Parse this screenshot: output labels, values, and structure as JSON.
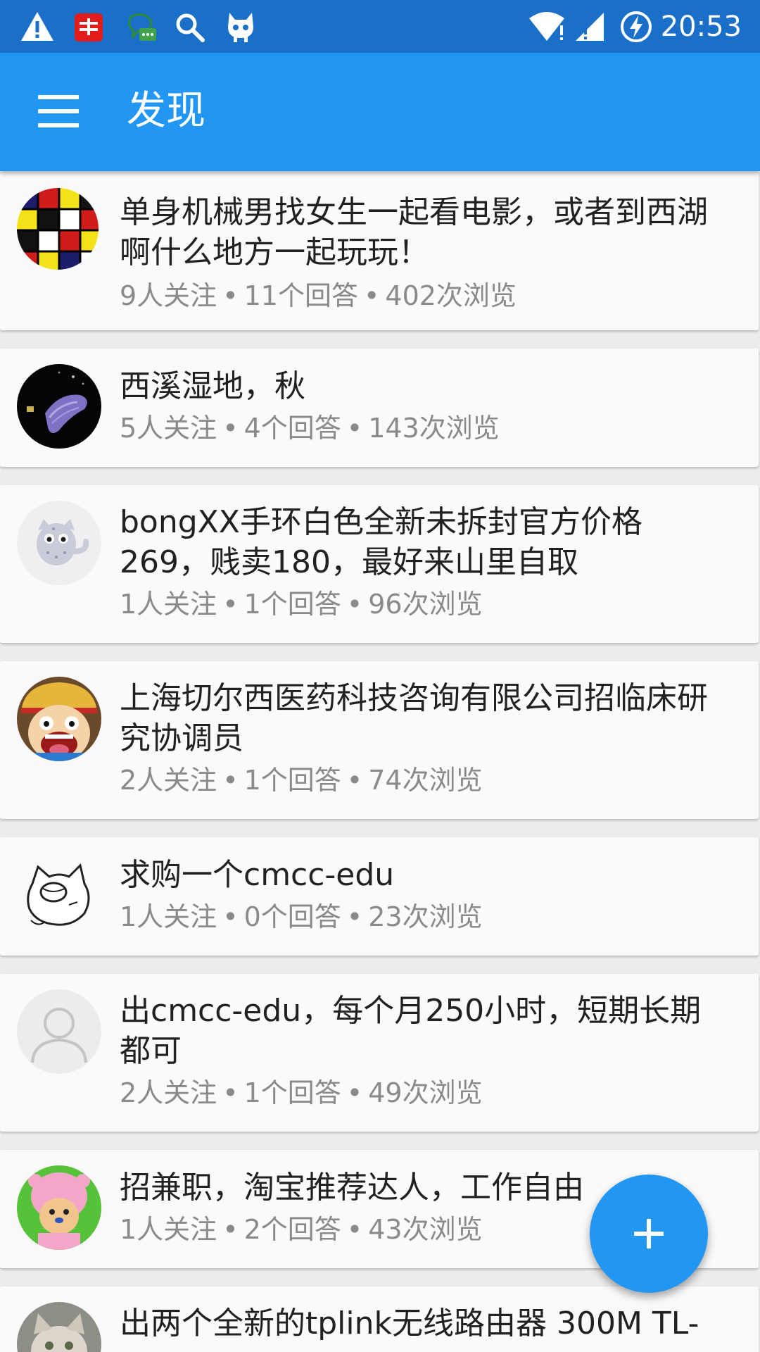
{
  "status_bar": {
    "time": "20:53",
    "icons": [
      "warning-icon",
      "youdao-app-icon",
      "chat-bubble-icon",
      "search-icon",
      "android-cat-icon",
      "wifi-icon",
      "signal-icon",
      "battery-charging-icon"
    ]
  },
  "app_bar": {
    "title": "发现",
    "menu_icon": "hamburger-menu-icon",
    "color": "#2196f3"
  },
  "questions": [
    {
      "title": "单身机械男找女生一起看电影，或者到西湖啊什么地方一起玩玩！",
      "follows": "9人关注",
      "answers": "11个回答",
      "views": "402次浏览",
      "avatar": "mondrian-avatar"
    },
    {
      "title": " 西溪湿地，秋",
      "follows": "5人关注",
      "answers": "4个回答",
      "views": "143次浏览",
      "avatar": "night-photo-avatar"
    },
    {
      "title": "bongXX手环白色全新未拆封官方价格269，贱卖180，最好来山里自取",
      "follows": "1人关注",
      "answers": "1个回答",
      "views": "96次浏览",
      "avatar": "gnome-toy-avatar"
    },
    {
      "title": "上海切尔西医药科技咨询有限公司招临床研究协调员",
      "follows": "2人关注",
      "answers": "1个回答",
      "views": "74次浏览",
      "avatar": "cartoon-face-avatar"
    },
    {
      "title": "求购一个cmcc-edu",
      "follows": "1人关注",
      "answers": "0个回答",
      "views": "23次浏览",
      "avatar": "sketch-cat-avatar"
    },
    {
      "title": "出cmcc-edu，每个月250小时，短期长期都可",
      "follows": "2人关注",
      "answers": "1个回答",
      "views": "49次浏览",
      "avatar": "default-user-avatar"
    },
    {
      "title": "招兼职，淘宝推荐达人，工作自由",
      "follows": "1人关注",
      "answers": "2个回答",
      "views": "43次浏览",
      "avatar": "pink-cartoon-avatar"
    },
    {
      "title": "出两个全新的tplink无线路由器 300M TL-",
      "follows": "",
      "answers": "",
      "views": "",
      "avatar": "kitten-avatar"
    }
  ],
  "meta_separator": "•",
  "fab": {
    "icon": "plus-icon",
    "color": "#2196f3"
  }
}
